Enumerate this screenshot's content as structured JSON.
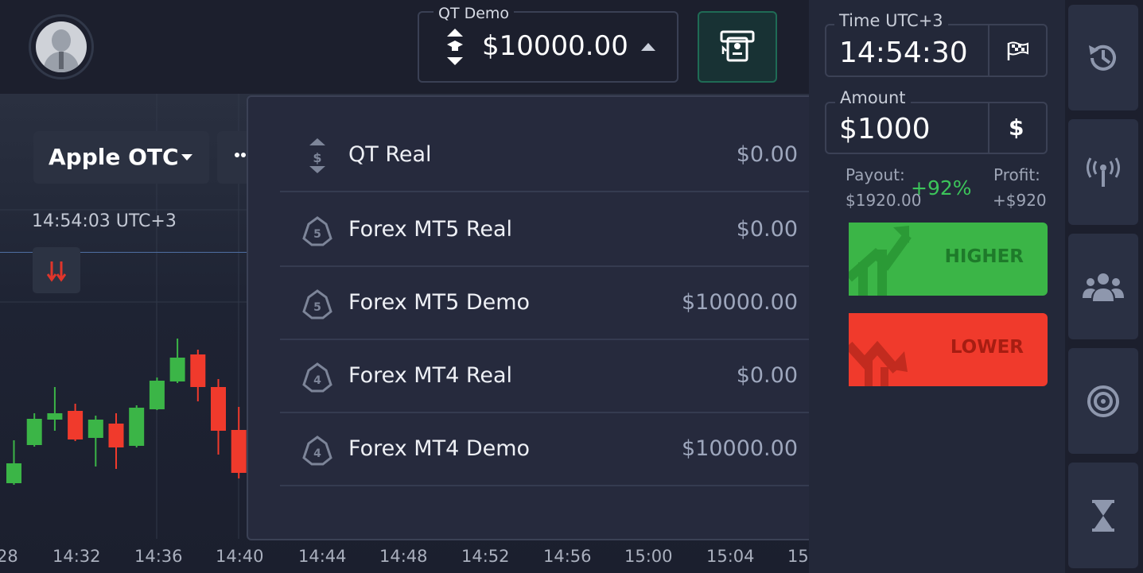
{
  "header": {
    "account": {
      "label": "QT Demo",
      "balance": "$10000.00"
    }
  },
  "chart": {
    "asset": "Apple OTC",
    "current_time": "14:54:03  UTC+3",
    "time_ticks": [
      "28",
      "14:32",
      "14:36",
      "14:40",
      "14:44",
      "14:48",
      "14:52",
      "14:56",
      "15:00",
      "15:04",
      "15"
    ],
    "candles": [
      {
        "o": 583,
        "c": 608,
        "h": 554,
        "l": 610,
        "up": true
      },
      {
        "o": 560,
        "c": 527,
        "h": 520,
        "l": 562,
        "up": true
      },
      {
        "o": 528,
        "c": 520,
        "h": 487,
        "l": 542,
        "up": true
      },
      {
        "o": 517,
        "c": 553,
        "h": 508,
        "l": 555,
        "up": false
      },
      {
        "o": 551,
        "c": 528,
        "h": 523,
        "l": 587,
        "up": true
      },
      {
        "o": 533,
        "c": 563,
        "h": 520,
        "l": 590,
        "up": false
      },
      {
        "o": 561,
        "c": 513,
        "h": 510,
        "l": 563,
        "up": true
      },
      {
        "o": 515,
        "c": 479,
        "h": 475,
        "l": 516,
        "up": true
      },
      {
        "o": 480,
        "c": 450,
        "h": 426,
        "l": 482,
        "up": true
      },
      {
        "o": 446,
        "c": 487,
        "h": 440,
        "l": 505,
        "up": false
      },
      {
        "o": 487,
        "c": 542,
        "h": 477,
        "l": 572,
        "up": false
      },
      {
        "o": 541,
        "c": 595,
        "h": 512,
        "l": 602,
        "up": false
      }
    ]
  },
  "account_menu": {
    "items": [
      {
        "name": "QT Real",
        "balance": "$0.00",
        "icon": "dollar-sort-icon"
      },
      {
        "name": "Forex MT5 Real",
        "balance": "$0.00",
        "icon": "mt5-icon"
      },
      {
        "name": "Forex MT5 Demo",
        "balance": "$10000.00",
        "icon": "mt5-icon"
      },
      {
        "name": "Forex MT4 Real",
        "balance": "$0.00",
        "icon": "mt4-icon"
      },
      {
        "name": "Forex MT4 Demo",
        "balance": "$10000.00",
        "icon": "mt4-icon"
      }
    ]
  },
  "trade": {
    "time_label": "Time UTC+3",
    "time_value": "14:54:30",
    "amount_label": "Amount",
    "amount_value": "$1000",
    "currency": "$",
    "payout_label": "Payout:",
    "payout_value": "$1920.00",
    "payout_percent": "+92%",
    "profit_label": "Profit:",
    "profit_value": "+$920",
    "higher_label": "HIGHER",
    "lower_label": "LOWER"
  },
  "sidebar": {
    "items": [
      "history-icon",
      "signals-icon",
      "social-trading-icon",
      "target-icon",
      "hourglass-icon"
    ]
  },
  "colors": {
    "up": "#3bb547",
    "down": "#f03a2c",
    "accent": "#1f6b55"
  }
}
